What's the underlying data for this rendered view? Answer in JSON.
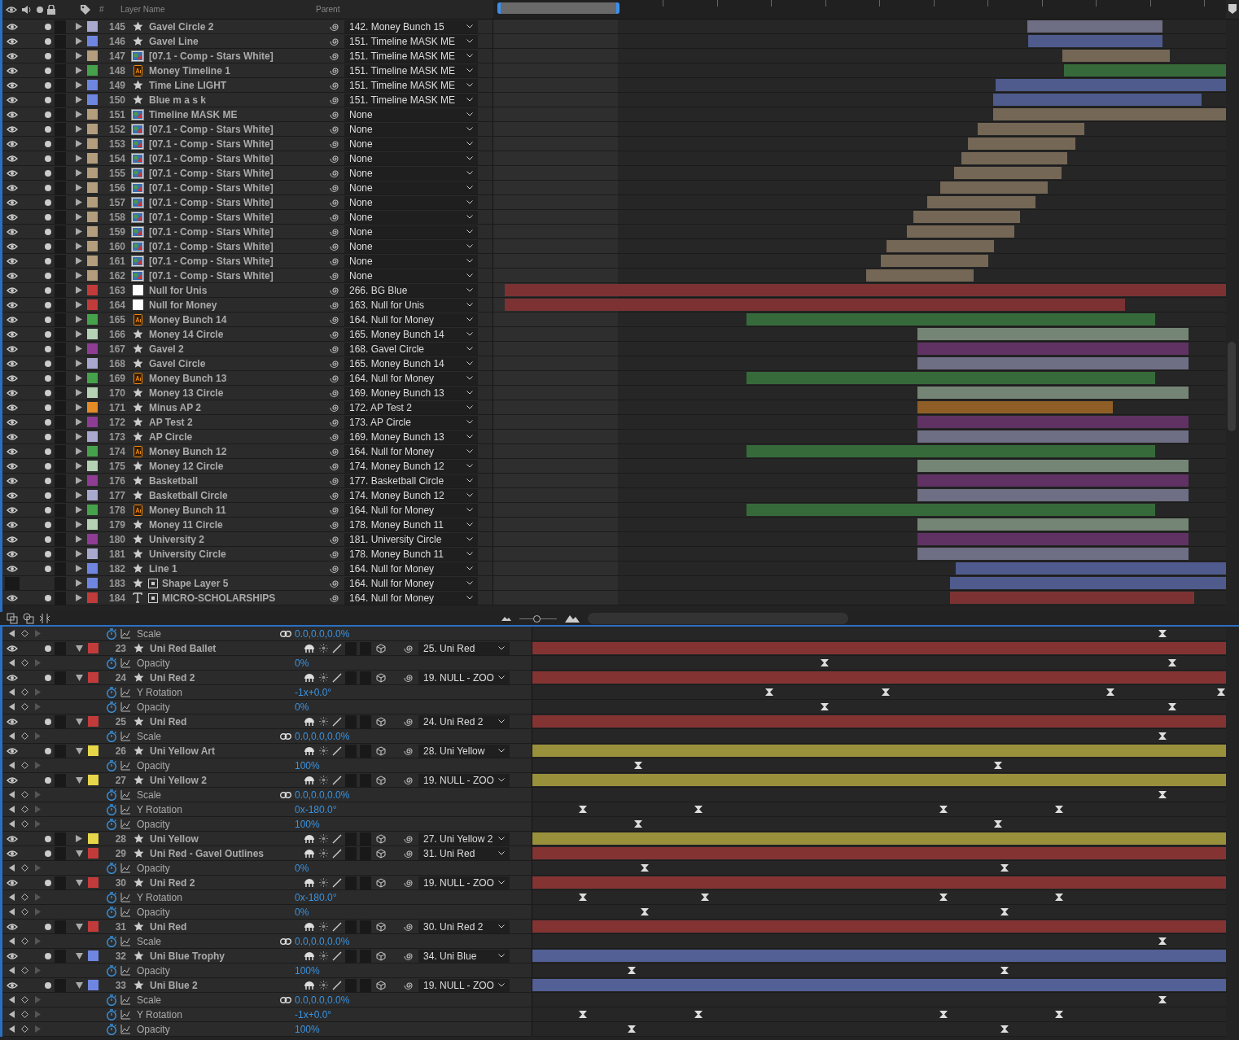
{
  "top_panel": {
    "columns": {
      "number": "#",
      "layer_name": "Layer Name",
      "parent": "Parent"
    },
    "layers": [
      {
        "number": "145",
        "name": "Gavel Circle 2",
        "kind": "star",
        "color": "#a9a9d0",
        "parent": "142. Money Bunch 15",
        "visible": true,
        "expanded": false
      },
      {
        "number": "146",
        "name": "Gavel Line",
        "kind": "star",
        "color": "#6f86e0",
        "parent": "151. Timeline MASK ME",
        "visible": true,
        "expanded": false
      },
      {
        "number": "147",
        "name": "[07.1 - Comp - Stars White]",
        "kind": "comp",
        "color": "#b39d7c",
        "parent": "151. Timeline MASK ME",
        "visible": true,
        "expanded": false
      },
      {
        "number": "148",
        "name": "Money Timeline 1",
        "kind": "ai",
        "color": "#45a24a",
        "parent": "151. Timeline MASK ME",
        "visible": true,
        "expanded": false
      },
      {
        "number": "149",
        "name": "Time Line LIGHT",
        "kind": "star",
        "color": "#6f86e0",
        "parent": "151. Timeline MASK ME",
        "visible": true,
        "expanded": false
      },
      {
        "number": "150",
        "name": "Blue m a s k",
        "kind": "star",
        "color": "#6f86e0",
        "parent": "151. Timeline MASK ME",
        "visible": true,
        "expanded": false
      },
      {
        "number": "151",
        "name": "Timeline MASK ME",
        "kind": "comp",
        "color": "#b39d7c",
        "parent": "None",
        "visible": true,
        "expanded": false
      },
      {
        "number": "152",
        "name": "[07.1 - Comp - Stars White]",
        "kind": "comp",
        "color": "#b39d7c",
        "parent": "None",
        "visible": true,
        "expanded": false
      },
      {
        "number": "153",
        "name": "[07.1 - Comp - Stars White]",
        "kind": "comp",
        "color": "#b39d7c",
        "parent": "None",
        "visible": true,
        "expanded": false
      },
      {
        "number": "154",
        "name": "[07.1 - Comp - Stars White]",
        "kind": "comp",
        "color": "#b39d7c",
        "parent": "None",
        "visible": true,
        "expanded": false
      },
      {
        "number": "155",
        "name": "[07.1 - Comp - Stars White]",
        "kind": "comp",
        "color": "#b39d7c",
        "parent": "None",
        "visible": true,
        "expanded": false
      },
      {
        "number": "156",
        "name": "[07.1 - Comp - Stars White]",
        "kind": "comp",
        "color": "#b39d7c",
        "parent": "None",
        "visible": true,
        "expanded": false
      },
      {
        "number": "157",
        "name": "[07.1 - Comp - Stars White]",
        "kind": "comp",
        "color": "#b39d7c",
        "parent": "None",
        "visible": true,
        "expanded": false
      },
      {
        "number": "158",
        "name": "[07.1 - Comp - Stars White]",
        "kind": "comp",
        "color": "#b39d7c",
        "parent": "None",
        "visible": true,
        "expanded": false
      },
      {
        "number": "159",
        "name": "[07.1 - Comp - Stars White]",
        "kind": "comp",
        "color": "#b39d7c",
        "parent": "None",
        "visible": true,
        "expanded": false
      },
      {
        "number": "160",
        "name": "[07.1 - Comp - Stars White]",
        "kind": "comp",
        "color": "#b39d7c",
        "parent": "None",
        "visible": true,
        "expanded": false
      },
      {
        "number": "161",
        "name": "[07.1 - Comp - Stars White]",
        "kind": "comp",
        "color": "#b39d7c",
        "parent": "None",
        "visible": true,
        "expanded": false
      },
      {
        "number": "162",
        "name": "[07.1 - Comp - Stars White]",
        "kind": "comp",
        "color": "#b39d7c",
        "parent": "None",
        "visible": true,
        "expanded": false
      },
      {
        "number": "163",
        "name": "Null for Unis",
        "kind": "null",
        "color": "#c23b3b",
        "parent": "266. BG Blue",
        "visible": true,
        "expanded": false
      },
      {
        "number": "164",
        "name": "Null for Money",
        "kind": "null",
        "color": "#c23b3b",
        "parent": "163. Null for Unis",
        "visible": true,
        "expanded": false
      },
      {
        "number": "165",
        "name": "Money Bunch 14",
        "kind": "ai",
        "color": "#45a24a",
        "parent": "164. Null for Money",
        "visible": true,
        "expanded": false
      },
      {
        "number": "166",
        "name": "Money 14 Circle",
        "kind": "star",
        "color": "#b5d2b5",
        "parent": "165. Money Bunch 14",
        "visible": true,
        "expanded": false
      },
      {
        "number": "167",
        "name": "Gavel 2",
        "kind": "star",
        "color": "#8e3c94",
        "parent": "168. Gavel Circle",
        "visible": true,
        "expanded": false
      },
      {
        "number": "168",
        "name": "Gavel Circle",
        "kind": "star",
        "color": "#a9a9d0",
        "parent": "165. Money Bunch 14",
        "visible": true,
        "expanded": false
      },
      {
        "number": "169",
        "name": "Money Bunch 13",
        "kind": "ai",
        "color": "#45a24a",
        "parent": "164. Null for Money",
        "visible": true,
        "expanded": false
      },
      {
        "number": "170",
        "name": "Money 13 Circle",
        "kind": "star",
        "color": "#b5d2b5",
        "parent": "169. Money Bunch 13",
        "visible": true,
        "expanded": false
      },
      {
        "number": "171",
        "name": "Minus AP 2",
        "kind": "star",
        "color": "#e58c26",
        "parent": "172. AP Test 2",
        "visible": true,
        "expanded": false
      },
      {
        "number": "172",
        "name": "AP Test 2",
        "kind": "star",
        "color": "#8e3c94",
        "parent": "173. AP Circle",
        "visible": true,
        "expanded": false
      },
      {
        "number": "173",
        "name": "AP Circle",
        "kind": "star",
        "color": "#a9a9d0",
        "parent": "169. Money Bunch 13",
        "visible": true,
        "expanded": false
      },
      {
        "number": "174",
        "name": "Money Bunch 12",
        "kind": "ai",
        "color": "#45a24a",
        "parent": "164. Null for Money",
        "visible": true,
        "expanded": false
      },
      {
        "number": "175",
        "name": "Money 12 Circle",
        "kind": "star",
        "color": "#b5d2b5",
        "parent": "174. Money Bunch 12",
        "visible": true,
        "expanded": false
      },
      {
        "number": "176",
        "name": "Basketball",
        "kind": "star",
        "color": "#8e3c94",
        "parent": "177. Basketball Circle",
        "visible": true,
        "expanded": false
      },
      {
        "number": "177",
        "name": "Basketball Circle",
        "kind": "star",
        "color": "#a9a9d0",
        "parent": "174. Money Bunch 12",
        "visible": true,
        "expanded": false
      },
      {
        "number": "178",
        "name": "Money Bunch 11",
        "kind": "ai",
        "color": "#45a24a",
        "parent": "164. Null for Money",
        "visible": true,
        "expanded": false
      },
      {
        "number": "179",
        "name": "Money 11 Circle",
        "kind": "star",
        "color": "#b5d2b5",
        "parent": "178. Money Bunch 11",
        "visible": true,
        "expanded": false
      },
      {
        "number": "180",
        "name": "University 2",
        "kind": "star",
        "color": "#8e3c94",
        "parent": "181. University Circle",
        "visible": true,
        "expanded": false
      },
      {
        "number": "181",
        "name": "University Circle",
        "kind": "star",
        "color": "#a9a9d0",
        "parent": "178. Money Bunch 11",
        "visible": true,
        "expanded": false
      },
      {
        "number": "182",
        "name": "Line 1",
        "kind": "star",
        "color": "#6f86e0",
        "parent": "164. Null for Money",
        "visible": true,
        "expanded": false
      },
      {
        "number": "183",
        "name": "Shape Layer 5",
        "kind": "shape",
        "color": "#6f86e0",
        "parent": "164. Null for Money",
        "visible": false,
        "expanded": false
      },
      {
        "number": "184",
        "name": "MICRO-SCHOLARSHIPS",
        "kind": "text",
        "color": "#c23b3b",
        "parent": "164. Null for Money",
        "visible": true,
        "expanded": false
      }
    ]
  },
  "timeline_zoom": {
    "level": 0.45
  },
  "bottom_panel": {
    "rows": [
      {
        "kind": "property",
        "name": "Scale",
        "value": "0.0,0.0,0.0%",
        "linked": true
      },
      {
        "kind": "layer",
        "number": "23",
        "name": "Uni Red Ballet",
        "color": "#c23b3b",
        "parent": "25. Uni Red",
        "expanded": true
      },
      {
        "kind": "property",
        "name": "Opacity",
        "value": "0%",
        "linked": false
      },
      {
        "kind": "layer",
        "number": "24",
        "name": "Uni Red 2",
        "color": "#c23b3b",
        "parent": "19. NULL - ZOO",
        "expanded": true
      },
      {
        "kind": "property",
        "name": "Y Rotation",
        "value": "-1x+0.0°",
        "linked": false
      },
      {
        "kind": "property",
        "name": "Opacity",
        "value": "0%",
        "linked": false
      },
      {
        "kind": "layer",
        "number": "25",
        "name": "Uni Red",
        "color": "#c23b3b",
        "parent": "24. Uni Red 2",
        "expanded": true
      },
      {
        "kind": "property",
        "name": "Scale",
        "value": "0.0,0.0,0.0%",
        "linked": true
      },
      {
        "kind": "layer",
        "number": "26",
        "name": "Uni Yellow Art",
        "color": "#e6d64a",
        "parent": "28. Uni Yellow",
        "expanded": true
      },
      {
        "kind": "property",
        "name": "Opacity",
        "value": "100%",
        "linked": false
      },
      {
        "kind": "layer",
        "number": "27",
        "name": "Uni Yellow 2",
        "color": "#e6d64a",
        "parent": "19. NULL - ZOO",
        "expanded": true
      },
      {
        "kind": "property",
        "name": "Scale",
        "value": "0.0,0.0,0.0%",
        "linked": true
      },
      {
        "kind": "property",
        "name": "Y Rotation",
        "value": "0x-180.0°",
        "linked": false
      },
      {
        "kind": "property",
        "name": "Opacity",
        "value": "100%",
        "linked": false
      },
      {
        "kind": "layer",
        "number": "28",
        "name": "Uni Yellow",
        "color": "#e6d64a",
        "parent": "27. Uni Yellow 2",
        "expanded": false
      },
      {
        "kind": "layer",
        "number": "29",
        "name": "Uni Red - Gavel Outlines",
        "color": "#c23b3b",
        "parent": "31. Uni Red",
        "expanded": true
      },
      {
        "kind": "property",
        "name": "Opacity",
        "value": "0%",
        "linked": false
      },
      {
        "kind": "layer",
        "number": "30",
        "name": "Uni Red 2",
        "color": "#c23b3b",
        "parent": "19. NULL - ZOO",
        "expanded": true
      },
      {
        "kind": "property",
        "name": "Y Rotation",
        "value": "0x-180.0°",
        "linked": false
      },
      {
        "kind": "property",
        "name": "Opacity",
        "value": "0%",
        "linked": false
      },
      {
        "kind": "layer",
        "number": "31",
        "name": "Uni Red",
        "color": "#c23b3b",
        "parent": "30. Uni Red 2",
        "expanded": true
      },
      {
        "kind": "property",
        "name": "Scale",
        "value": "0.0,0.0,0.0%",
        "linked": true
      },
      {
        "kind": "layer",
        "number": "32",
        "name": "Uni Blue Trophy",
        "color": "#6f86e0",
        "parent": "34. Uni Blue",
        "expanded": true
      },
      {
        "kind": "property",
        "name": "Opacity",
        "value": "100%",
        "linked": false
      },
      {
        "kind": "layer",
        "number": "33",
        "name": "Uni Blue 2",
        "color": "#6f86e0",
        "parent": "19. NULL - ZOO",
        "expanded": true
      },
      {
        "kind": "property",
        "name": "Scale",
        "value": "0.0,0.0,0.0%",
        "linked": true
      },
      {
        "kind": "property",
        "name": "Y Rotation",
        "value": "-1x+0.0°",
        "linked": false
      },
      {
        "kind": "property",
        "name": "Opacity",
        "value": "100%",
        "linked": false
      }
    ]
  }
}
